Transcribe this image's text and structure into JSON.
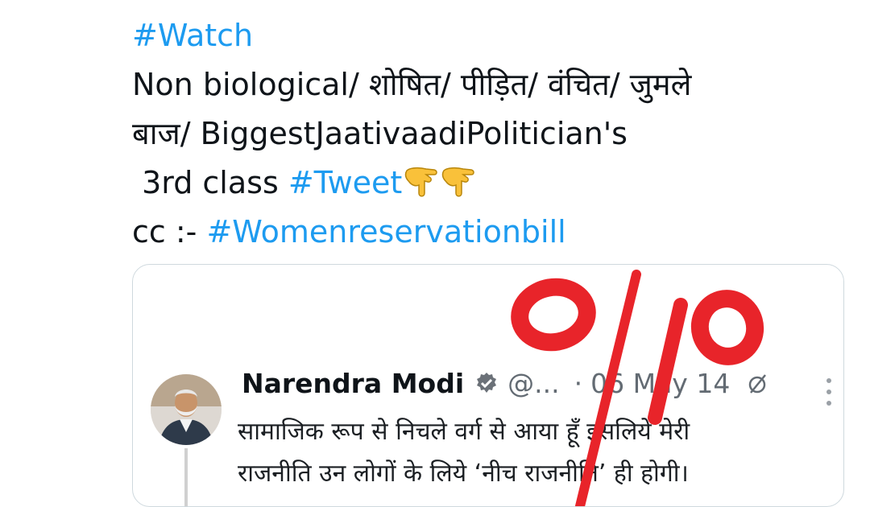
{
  "tweet": {
    "hashtag_watch": "#Watch",
    "line2": "Non biological/ शोषित/ पीड़ित/ वंचित/ जुमले",
    "line3": "बाज/ BiggestJaativaadiPolitician's",
    "line4_prefix": " 3rd class ",
    "hashtag_tweet": "#Tweet",
    "emoji": "pointing-down-emoji",
    "line5_prefix": "cc :- ",
    "hashtag_bill": "#Womenreservationbill"
  },
  "embedded_tweet": {
    "author_name": "Narendra Modi",
    "verified_icon": "verified-badge-icon",
    "handle": "@...",
    "separator": "·",
    "date": "06 May 14",
    "body_line1": "सामाजिक रूप से निचले वर्ग से आया हूँ इसलिये मेरी",
    "body_line2": "राजनीति उन लोगों के लिये ‘नीच राजनीति’ ही होगी।",
    "annotation": "0/10"
  },
  "colors": {
    "hashtag": "#1d9bf0",
    "text": "#0f1419",
    "annotation_red": "#e8242a"
  }
}
